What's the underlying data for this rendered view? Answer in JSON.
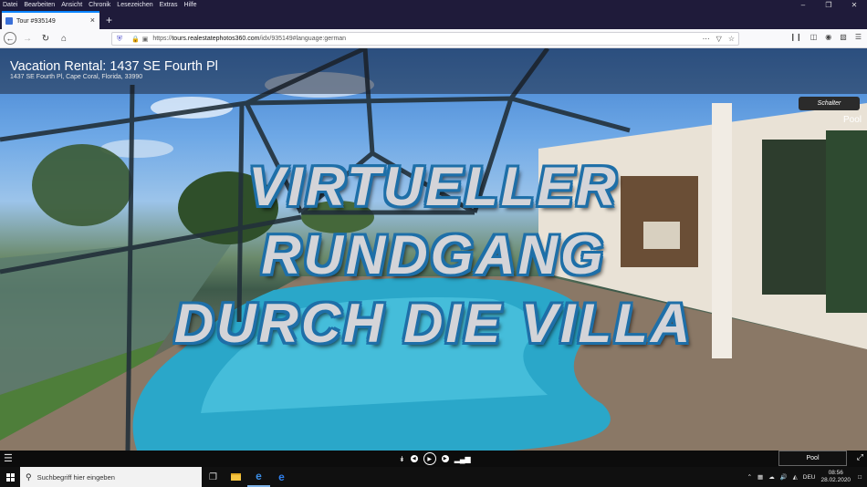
{
  "browser": {
    "menu": [
      "Datei",
      "Bearbeiten",
      "Ansicht",
      "Chronik",
      "Lesezeichen",
      "Extras",
      "Hilfe"
    ],
    "tab_title": "Tour #935149",
    "url_domain": "tours.realestatephotos360.com",
    "url_prefix": "https://",
    "url_path": "/idx/935149#language:german"
  },
  "tour": {
    "title": "Vacation Rental: 1437 SE Fourth Pl",
    "address": "1437 SE Fourth Pl, Cape Coral, Florida, 33990",
    "schalter_label": "Schalter",
    "scene_name": "Pool",
    "overlay_lines": [
      "VIRTUELLER",
      "RUNDGANG",
      "DURCH DIE VILLA"
    ],
    "pool_button": "Pool"
  },
  "taskbar": {
    "search_placeholder": "Suchbegriff hier eingeben",
    "language": "DEU",
    "time": "08:56",
    "date": "28.02.2020"
  }
}
